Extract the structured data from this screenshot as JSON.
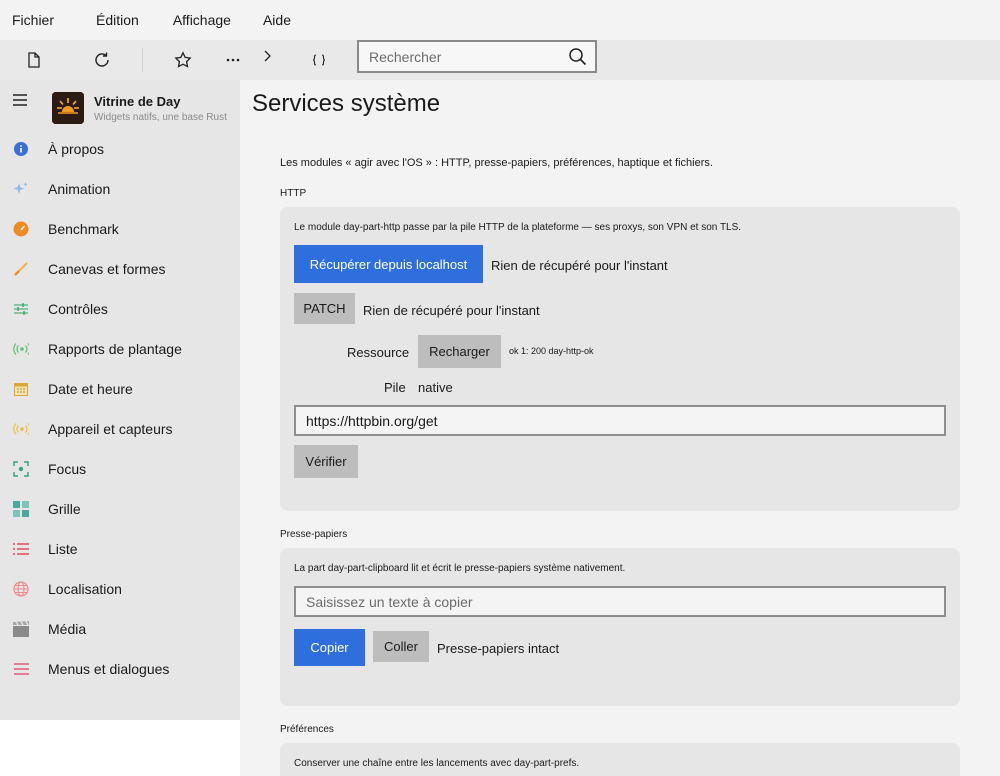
{
  "menu": [
    "Fichier",
    "Édition",
    "Affichage",
    "Aide"
  ],
  "toolbar": {
    "search_placeholder": "Rechercher",
    "icons": [
      "new-file-icon",
      "refresh-icon",
      "star-icon",
      "more-icon",
      "chevron-right-icon",
      "braces-icon",
      "search-icon"
    ]
  },
  "app": {
    "title": "Vitrine de Day",
    "subtitle": "Widgets natifs, une base Rust"
  },
  "sidebar": {
    "items": [
      {
        "label": "À propos",
        "icon": "info-icon",
        "color": "#3b6fd6"
      },
      {
        "label": "Animation",
        "icon": "sparkle-icon",
        "color": "#8fb8e8"
      },
      {
        "label": "Benchmark",
        "icon": "gauge-icon",
        "color": "#f08a24"
      },
      {
        "label": "Canevas et formes",
        "icon": "brush-icon",
        "color": "#f0a040"
      },
      {
        "label": "Contrôles",
        "icon": "sliders-icon",
        "color": "#4caf7a"
      },
      {
        "label": "Rapports de plantage",
        "icon": "broadcast-icon",
        "color": "#5fbf6f"
      },
      {
        "label": "Date et heure",
        "icon": "calendar-icon",
        "color": "#d8a83a"
      },
      {
        "label": "Appareil et capteurs",
        "icon": "sensor-icon",
        "color": "#e8c040"
      },
      {
        "label": "Focus",
        "icon": "focus-icon",
        "color": "#3aa37a"
      },
      {
        "label": "Grille",
        "icon": "grid-icon",
        "color": "#4ca89a"
      },
      {
        "label": "Liste",
        "icon": "list-icon",
        "color": "#e04a5a"
      },
      {
        "label": "Localisation",
        "icon": "globe-icon",
        "color": "#f08a8a"
      },
      {
        "label": "Média",
        "icon": "clapper-icon",
        "color": "#8a8a8a"
      },
      {
        "label": "Menus et dialogues",
        "icon": "menu-lines-icon",
        "color": "#e05a7a"
      }
    ]
  },
  "main": {
    "title": "Services système",
    "intro": "Les modules « agir avec l'OS » : HTTP, presse-papiers, préférences, haptique et fichiers.",
    "http": {
      "label": "HTTP",
      "desc": "Le module day-part-http passe par la pile HTTP de la plateforme — ses proxys, son VPN et son TLS.",
      "fetch_button": "Récupérer depuis localhost",
      "fetch_status": "Rien de récupéré pour l'instant",
      "patch_button": "PATCH",
      "patch_status": "Rien de récupéré pour l'instant",
      "resource_label": "Ressource",
      "reload_button": "Recharger",
      "resource_status": "ok 1: 200 day-http-ok",
      "stack_label": "Pile",
      "stack_value": "native",
      "url_value": "https://httpbin.org/get",
      "verify_button": "Vérifier"
    },
    "clipboard": {
      "label": "Presse-papiers",
      "desc": "La part day-part-clipboard lit et écrit le presse-papiers système nativement.",
      "placeholder": "Saisissez un texte à copier",
      "copy_button": "Copier",
      "paste_button": "Coller",
      "status": "Presse-papiers intact"
    },
    "prefs": {
      "label": "Préférences",
      "desc": "Conserver une chaîne entre les lancements avec day-part-prefs."
    }
  },
  "colors": {
    "accent": "#2f6fdd",
    "sidebar_bg": "#e6e6e6",
    "card_bg": "#e6e6e6"
  }
}
